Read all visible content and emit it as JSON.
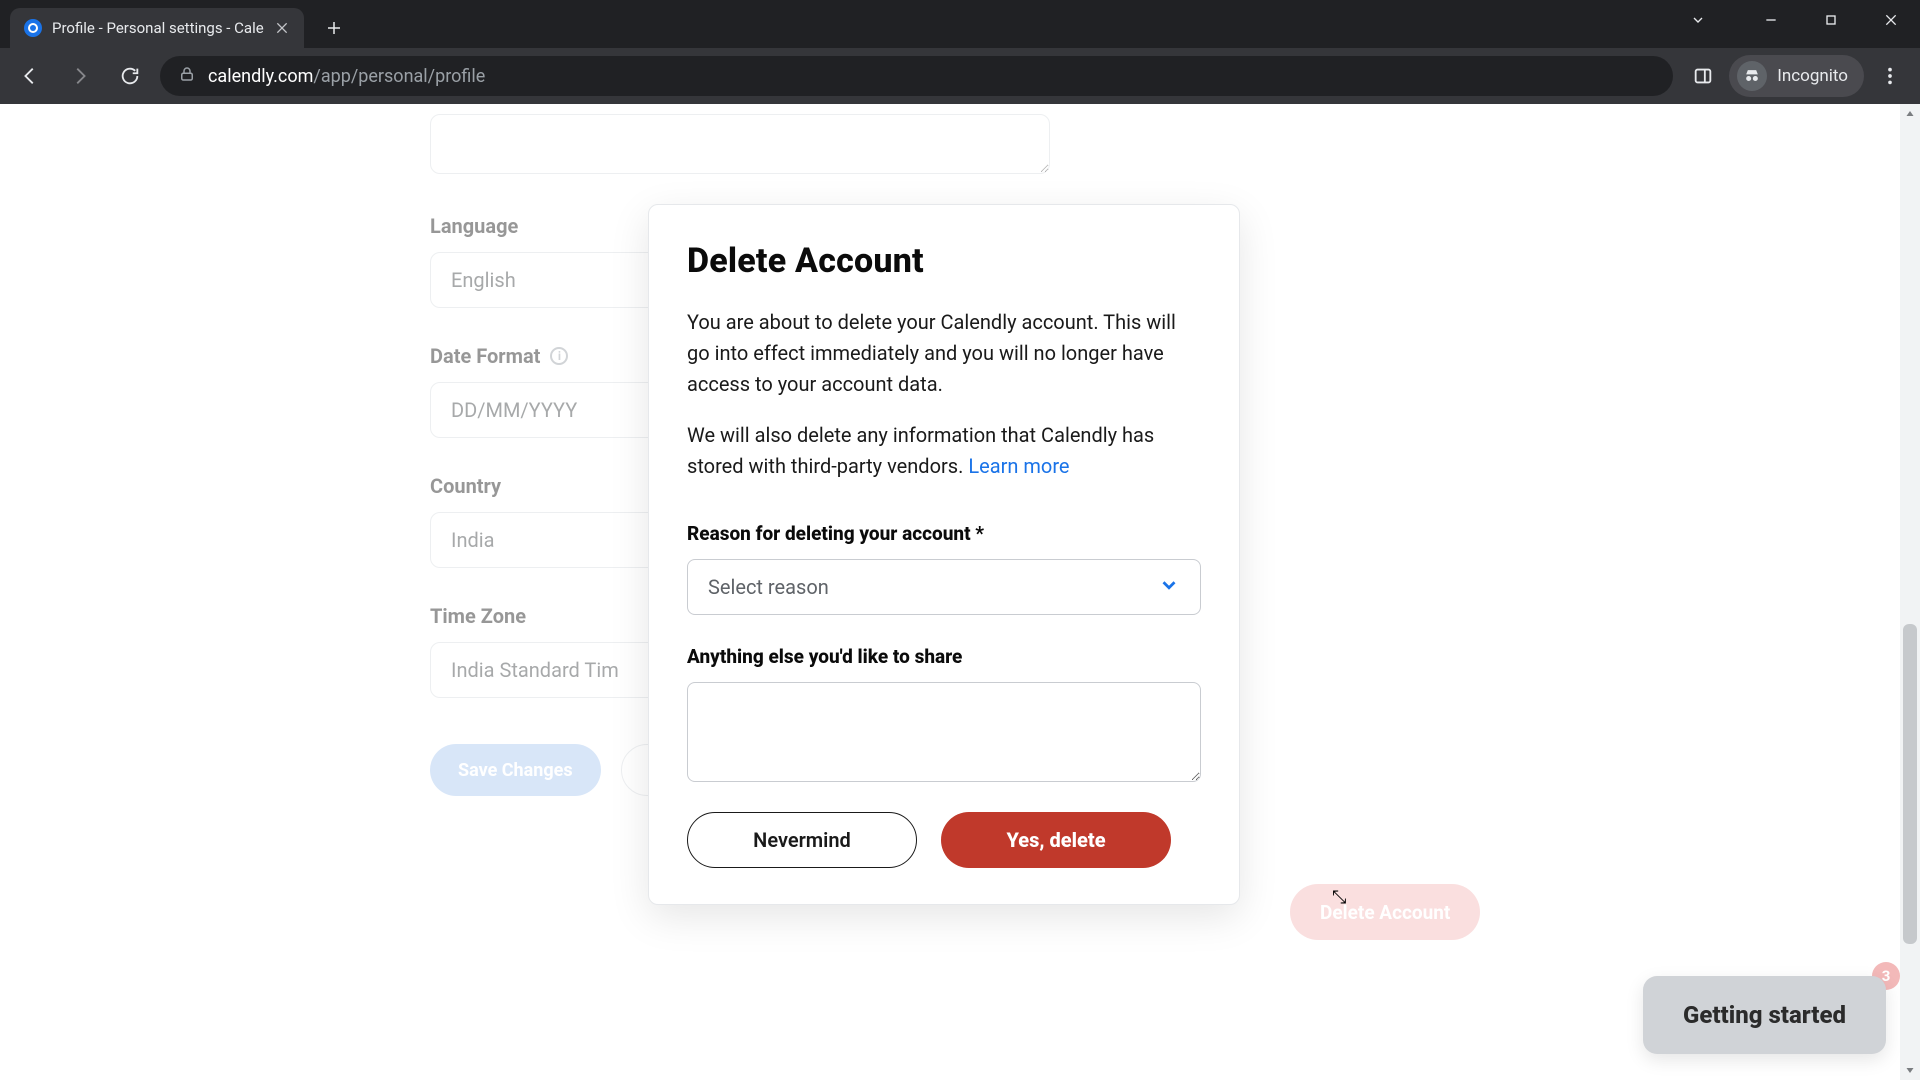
{
  "browser": {
    "tab_title": "Profile - Personal settings - Cale",
    "url_host": "calendly.com",
    "url_path": "/app/personal/profile",
    "incognito_label": "Incognito"
  },
  "form": {
    "language_label": "Language",
    "language_value": "English",
    "date_format_label": "Date Format",
    "date_format_value": "DD/MM/YYYY",
    "country_label": "Country",
    "country_value": "India",
    "timezone_label": "Time Zone",
    "timezone_value": "India Standard Tim",
    "save_label": "Save Changes",
    "delete_label": "Delete Account"
  },
  "modal": {
    "title": "Delete Account",
    "p1": "You are about to delete your Calendly account. This will go into effect immediately and you will no longer have access to your account data.",
    "p2a": "We will also delete any information that Calendly has stored with third-party vendors. ",
    "learn_more": "Learn more",
    "reason_label": "Reason for deleting your account *",
    "reason_placeholder": "Select reason",
    "share_label": "Anything else you'd like to share",
    "nevermind": "Nevermind",
    "yes_delete": "Yes, delete"
  },
  "widgets": {
    "getting_started": "Getting started",
    "gs_count": "3"
  }
}
